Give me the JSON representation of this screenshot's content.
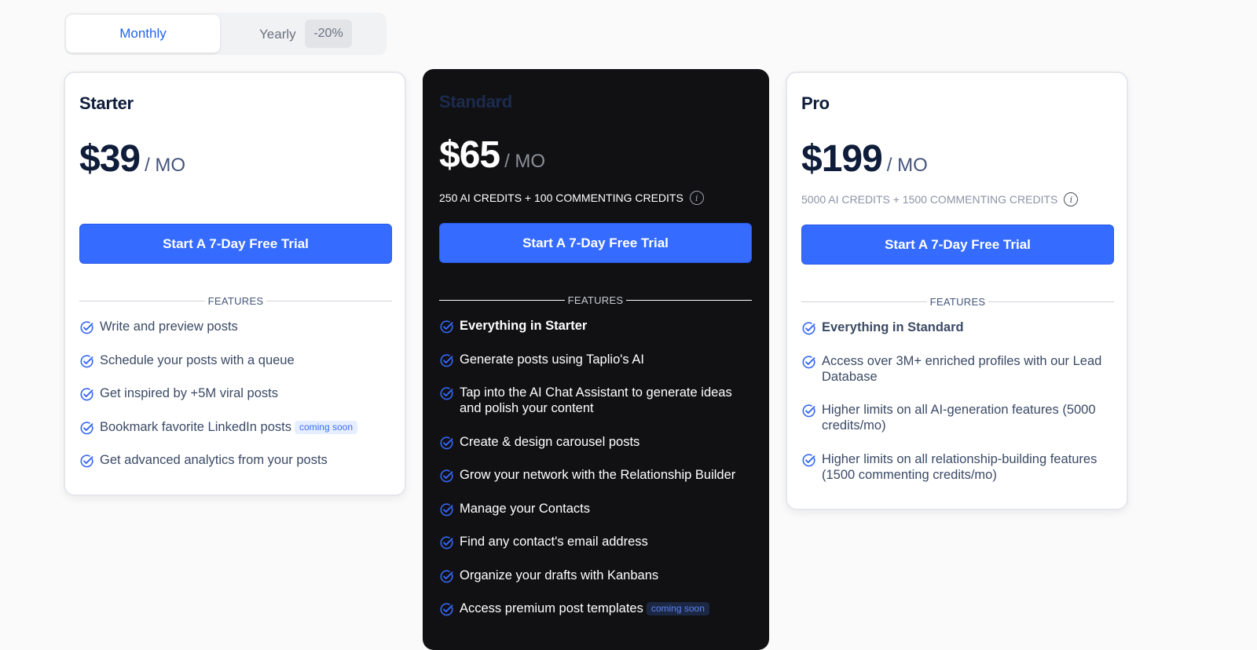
{
  "billing_toggle": {
    "monthly_label": "Monthly",
    "yearly_label": "Yearly",
    "discount_label": "-20%"
  },
  "plans": [
    {
      "name": "Starter",
      "price": "$39",
      "unit": "/ MO",
      "credits": "",
      "cta": "Start A 7-Day Free Trial",
      "features_label": "FEATURES",
      "features": [
        {
          "text": "Write and preview posts"
        },
        {
          "text": "Schedule your posts with a queue"
        },
        {
          "text": "Get inspired by +5M viral posts"
        },
        {
          "text": "Bookmark favorite LinkedIn posts",
          "badge": "coming soon"
        },
        {
          "text": "Get advanced analytics from your posts"
        }
      ]
    },
    {
      "name": "Standard",
      "price": "$65",
      "unit": "/ MO",
      "credits": "250 AI CREDITS + 100 COMMENTING CREDITS",
      "cta": "Start A 7-Day Free Trial",
      "features_label": "FEATURES",
      "features": [
        {
          "text": "Everything in Starter",
          "bold": true
        },
        {
          "text": "Generate posts using Taplio's AI"
        },
        {
          "text": "Tap into the AI Chat Assistant to generate ideas and polish your content"
        },
        {
          "text": "Create & design carousel posts"
        },
        {
          "text": "Grow your network with the Relationship Builder"
        },
        {
          "text": "Manage your Contacts"
        },
        {
          "text": "Find any contact's email address"
        },
        {
          "text": "Organize your drafts with Kanbans"
        },
        {
          "text": "Access premium post templates",
          "badge": "coming soon"
        }
      ]
    },
    {
      "name": "Pro",
      "price": "$199",
      "unit": "/ MO",
      "credits": "5000 AI CREDITS + 1500 COMMENTING CREDITS",
      "cta": "Start A 7-Day Free Trial",
      "features_label": "FEATURES",
      "features": [
        {
          "text": "Everything in Standard",
          "bold": true
        },
        {
          "text": "Access over 3M+ enriched profiles with our Lead Database"
        },
        {
          "text": "Higher limits on all AI-generation features (5000 credits/mo)"
        },
        {
          "text": "Higher limits on all relationship-building features (1500 commenting credits/mo)"
        }
      ]
    }
  ],
  "colors": {
    "accent": "#356bff",
    "dark_card": "#111114",
    "text": "#3b4a66"
  }
}
